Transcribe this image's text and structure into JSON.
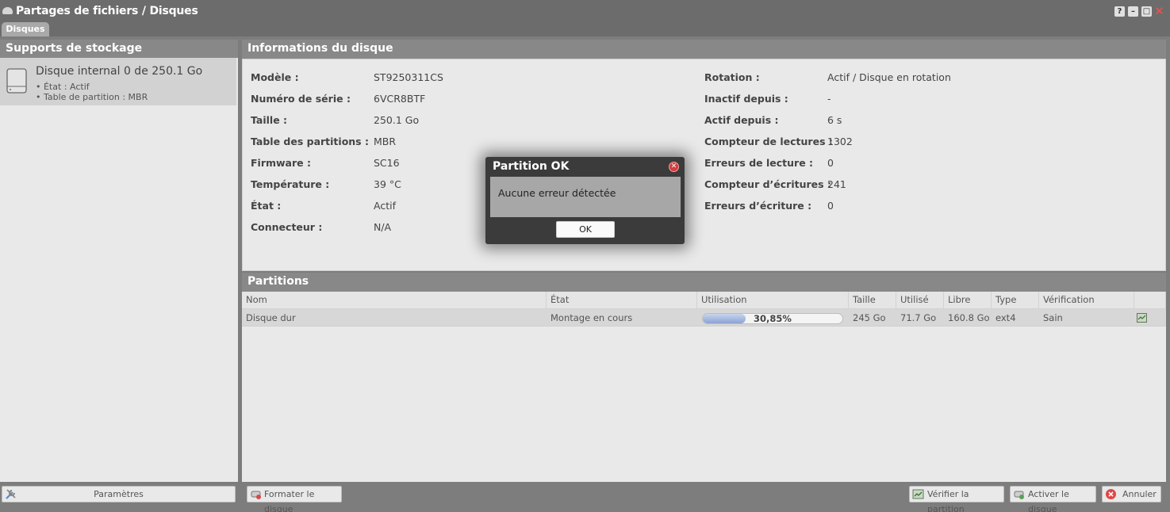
{
  "window": {
    "title": "Partages de fichiers / Disques",
    "help": "?",
    "minimize": "–",
    "maximize": "□",
    "close": "✕"
  },
  "tabs": [
    {
      "label": "Disques"
    }
  ],
  "storage": {
    "header": "Supports de stockage",
    "disk": {
      "name": "Disque internal 0 de 250.1 Go",
      "state_line": "• État : Actif",
      "partition_line": "• Table de partition : MBR"
    },
    "params_label": "Paramètres"
  },
  "info": {
    "header": "Informations du disque",
    "left": [
      {
        "label": "Modèle :",
        "value": "ST9250311CS"
      },
      {
        "label": "Numéro de série :",
        "value": "6VCR8BTF"
      },
      {
        "label": "Taille :",
        "value": "250.1 Go"
      },
      {
        "label": "Table des partitions :",
        "value": "MBR"
      },
      {
        "label": "Firmware :",
        "value": "SC16"
      },
      {
        "label": "Température :",
        "value": "39 °C"
      },
      {
        "label": "État :",
        "value": "Actif"
      },
      {
        "label": "Connecteur :",
        "value": "N/A"
      }
    ],
    "right": [
      {
        "label": "Rotation :",
        "value": "Actif / Disque en rotation"
      },
      {
        "label": "Inactif depuis :",
        "value": "-"
      },
      {
        "label": "Actif depuis :",
        "value": "6 s"
      },
      {
        "label": "Compteur de lectures :",
        "value": "1302"
      },
      {
        "label": "Erreurs de lecture :",
        "value": "0"
      },
      {
        "label": "Compteur d’écritures :",
        "value": "241"
      },
      {
        "label": "Erreurs d’écriture :",
        "value": "0"
      }
    ]
  },
  "partitions": {
    "header": "Partitions",
    "columns": [
      "Nom",
      "État",
      "Utilisation",
      "Taille",
      "Utilisé",
      "Libre",
      "Type",
      "Vérification"
    ],
    "rows": [
      {
        "name": "Disque dur",
        "state": "Montage en cours",
        "usage_text": "30,85%",
        "usage_fraction": 0.3085,
        "size": "245 Go",
        "used": "71.7 Go",
        "free": "160.8 Go",
        "type": "ext4",
        "check": "Sain"
      }
    ]
  },
  "footer": {
    "format_label": "Formater le disque",
    "verify_label": "Vérifier la partition",
    "activate_label": "Activer le disque",
    "cancel_label": "Annuler"
  },
  "dialog": {
    "title": "Partition OK",
    "message": "Aucune erreur détectée",
    "ok_label": "OK"
  },
  "colors": {
    "progress_fill": "#8ba3d4",
    "error_red": "#d63c3c",
    "header_grey": "#888888"
  }
}
